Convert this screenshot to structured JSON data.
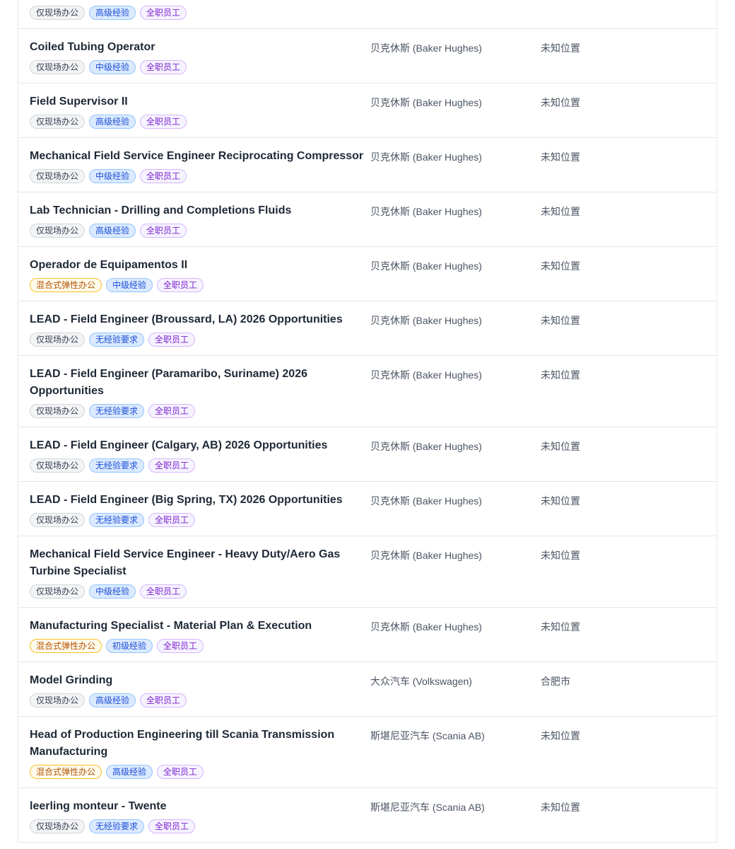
{
  "jobs": [
    {
      "title": "",
      "company": "",
      "location": "",
      "tags": [
        {
          "label": "仅现场办公",
          "tone": "gray"
        },
        {
          "label": "高级经验",
          "tone": "blue"
        },
        {
          "label": "全职员工",
          "tone": "purple"
        }
      ]
    },
    {
      "title": "Coiled Tubing Operator",
      "company": "贝克休斯 (Baker Hughes)",
      "location": "未知位置",
      "tags": [
        {
          "label": "仅现场办公",
          "tone": "gray"
        },
        {
          "label": "中级经验",
          "tone": "blue"
        },
        {
          "label": "全职员工",
          "tone": "purple"
        }
      ]
    },
    {
      "title": "Field Supervisor II",
      "company": "贝克休斯 (Baker Hughes)",
      "location": "未知位置",
      "tags": [
        {
          "label": "仅现场办公",
          "tone": "gray"
        },
        {
          "label": "高级经验",
          "tone": "blue"
        },
        {
          "label": "全职员工",
          "tone": "purple"
        }
      ]
    },
    {
      "title": "Mechanical Field Service Engineer Reciprocating Compressor",
      "company": "贝克休斯 (Baker Hughes)",
      "location": "未知位置",
      "tags": [
        {
          "label": "仅现场办公",
          "tone": "gray"
        },
        {
          "label": "中级经验",
          "tone": "blue"
        },
        {
          "label": "全职员工",
          "tone": "purple"
        }
      ]
    },
    {
      "title": "Lab Technician - Drilling and Completions Fluids",
      "company": "贝克休斯 (Baker Hughes)",
      "location": "未知位置",
      "tags": [
        {
          "label": "仅现场办公",
          "tone": "gray"
        },
        {
          "label": "高级经验",
          "tone": "blue"
        },
        {
          "label": "全职员工",
          "tone": "purple"
        }
      ]
    },
    {
      "title": "Operador de Equipamentos II",
      "company": "贝克休斯 (Baker Hughes)",
      "location": "未知位置",
      "tags": [
        {
          "label": "混合式弹性办公",
          "tone": "yellow"
        },
        {
          "label": "中级经验",
          "tone": "blue"
        },
        {
          "label": "全职员工",
          "tone": "purple"
        }
      ]
    },
    {
      "title": "LEAD - Field Engineer (Broussard, LA) 2026 Opportunities",
      "company": "贝克休斯 (Baker Hughes)",
      "location": "未知位置",
      "tags": [
        {
          "label": "仅现场办公",
          "tone": "gray"
        },
        {
          "label": "无经验要求",
          "tone": "blue"
        },
        {
          "label": "全职员工",
          "tone": "purple"
        }
      ]
    },
    {
      "title": "LEAD - Field Engineer (Paramaribo, Suriname) 2026 Opportunities",
      "company": "贝克休斯 (Baker Hughes)",
      "location": "未知位置",
      "tags": [
        {
          "label": "仅现场办公",
          "tone": "gray"
        },
        {
          "label": "无经验要求",
          "tone": "blue"
        },
        {
          "label": "全职员工",
          "tone": "purple"
        }
      ]
    },
    {
      "title": "LEAD - Field Engineer (Calgary, AB) 2026 Opportunities",
      "company": "贝克休斯 (Baker Hughes)",
      "location": "未知位置",
      "tags": [
        {
          "label": "仅现场办公",
          "tone": "gray"
        },
        {
          "label": "无经验要求",
          "tone": "blue"
        },
        {
          "label": "全职员工",
          "tone": "purple"
        }
      ]
    },
    {
      "title": "LEAD - Field Engineer (Big Spring, TX) 2026 Opportunities",
      "company": "贝克休斯 (Baker Hughes)",
      "location": "未知位置",
      "tags": [
        {
          "label": "仅现场办公",
          "tone": "gray"
        },
        {
          "label": "无经验要求",
          "tone": "blue"
        },
        {
          "label": "全职员工",
          "tone": "purple"
        }
      ]
    },
    {
      "title": "Mechanical Field Service Engineer - Heavy Duty/Aero Gas Turbine Specialist",
      "company": "贝克休斯 (Baker Hughes)",
      "location": "未知位置",
      "tags": [
        {
          "label": "仅现场办公",
          "tone": "gray"
        },
        {
          "label": "中级经验",
          "tone": "blue"
        },
        {
          "label": "全职员工",
          "tone": "purple"
        }
      ]
    },
    {
      "title": "Manufacturing Specialist - Material Plan & Execution",
      "company": "贝克休斯 (Baker Hughes)",
      "location": "未知位置",
      "tags": [
        {
          "label": "混合式弹性办公",
          "tone": "yellow"
        },
        {
          "label": "初级经验",
          "tone": "blue"
        },
        {
          "label": "全职员工",
          "tone": "purple"
        }
      ]
    },
    {
      "title": "Model Grinding",
      "company": "大众汽车 (Volkswagen)",
      "location": "合肥市",
      "tags": [
        {
          "label": "仅现场办公",
          "tone": "gray"
        },
        {
          "label": "高级经验",
          "tone": "blue"
        },
        {
          "label": "全职员工",
          "tone": "purple"
        }
      ]
    },
    {
      "title": "Head of Production Engineering till Scania Transmission Manufacturing",
      "company": "斯堪尼亚汽车 (Scania AB)",
      "location": "未知位置",
      "tags": [
        {
          "label": "混合式弹性办公",
          "tone": "yellow"
        },
        {
          "label": "高级经验",
          "tone": "blue"
        },
        {
          "label": "全职员工",
          "tone": "purple"
        }
      ]
    },
    {
      "title": "leerling monteur - Twente",
      "company": "斯堪尼亚汽车 (Scania AB)",
      "location": "未知位置",
      "tags": [
        {
          "label": "仅现场办公",
          "tone": "gray"
        },
        {
          "label": "无经验要求",
          "tone": "blue"
        },
        {
          "label": "全职员工",
          "tone": "purple"
        }
      ]
    }
  ]
}
